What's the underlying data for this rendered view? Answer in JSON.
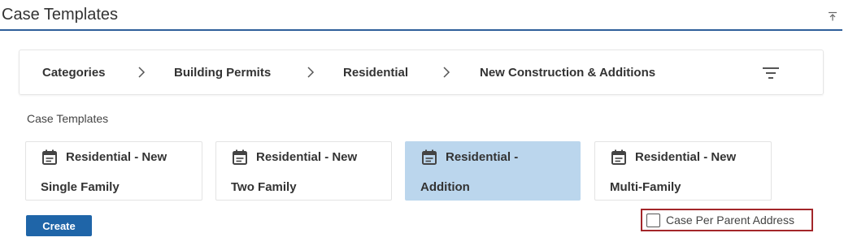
{
  "header": {
    "title": "Case Templates",
    "collapse_icon": "collapse-up-icon"
  },
  "breadcrumb": {
    "items": [
      "Categories",
      "Building Permits",
      "Residential",
      "New Construction & Additions"
    ],
    "separator_icon": "chevron-right-icon",
    "filter_icon": "filter-icon"
  },
  "templates": {
    "section_label": "Case Templates",
    "selected_color": "#bbd6ed",
    "cards": [
      {
        "line1": "Residential - New",
        "line2": "Single Family",
        "selected": false,
        "icon": "calendar-icon"
      },
      {
        "line1": "Residential - New",
        "line2": "Two Family",
        "selected": false,
        "icon": "calendar-icon"
      },
      {
        "line1": "Residential -",
        "line2": "Addition",
        "selected": true,
        "icon": "calendar-icon"
      },
      {
        "line1": "Residential - New",
        "line2": "Multi-Family",
        "selected": false,
        "icon": "calendar-icon"
      }
    ]
  },
  "actions": {
    "create_label": "Create",
    "create_color": "#1f65a8"
  },
  "options": {
    "case_per_parent_label": "Case Per Parent Address",
    "case_per_parent_checked": false,
    "highlight_color": "#a3262a"
  }
}
